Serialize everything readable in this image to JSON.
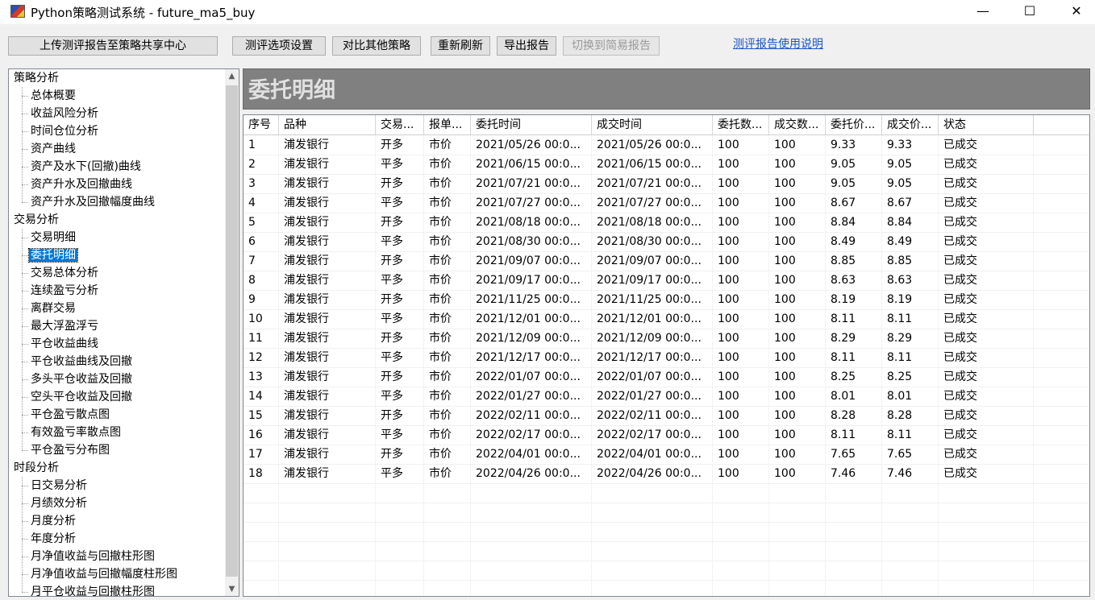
{
  "window": {
    "title": "Python策略测试系统 - future_ma5_buy",
    "minimize": "—",
    "maximize": "☐",
    "close": "✕"
  },
  "toolbar": {
    "upload": "上传测评报告至策略共享中心",
    "options": "测评选项设置",
    "compare": "对比其他策略",
    "refresh": "重新刷新",
    "export": "导出报告",
    "simple": "切换到简易报告",
    "help_link": "测评报告使用说明"
  },
  "tree": {
    "groups": [
      {
        "label": "策略分析",
        "items": [
          "总体概要",
          "收益风险分析",
          "时间仓位分析",
          "资产曲线",
          "资产及水下(回撤)曲线",
          "资产升水及回撤曲线",
          "资产升水及回撤幅度曲线"
        ]
      },
      {
        "label": "交易分析",
        "items": [
          "交易明细",
          "委托明细",
          "交易总体分析",
          "连续盈亏分析",
          "离群交易",
          "最大浮盈浮亏",
          "平仓收益曲线",
          "平仓收益曲线及回撤",
          "多头平仓收益及回撤",
          "空头平仓收益及回撤",
          "平仓盈亏散点图",
          "有效盈亏率散点图",
          "平仓盈亏分布图"
        ]
      },
      {
        "label": "时段分析",
        "items": [
          "日交易分析",
          "月绩效分析",
          "月度分析",
          "年度分析",
          "月净值收益与回撤柱形图",
          "月净值收益与回撤幅度柱形图",
          "月平仓收益与回撤柱形图"
        ]
      }
    ],
    "selected": "委托明细"
  },
  "panel": {
    "title": "委托明细"
  },
  "table": {
    "columns": [
      "序号",
      "品种",
      "交易...",
      "报单...",
      "委托时间",
      "成交时间",
      "委托数...",
      "成交数...",
      "委托价...",
      "成交价...",
      "状态"
    ],
    "rows": [
      [
        "1",
        "浦发银行",
        "开多",
        "市价",
        "2021/05/26 00:0...",
        "2021/05/26 00:0...",
        "100",
        "100",
        "9.33",
        "9.33",
        "已成交"
      ],
      [
        "2",
        "浦发银行",
        "平多",
        "市价",
        "2021/06/15 00:0...",
        "2021/06/15 00:0...",
        "100",
        "100",
        "9.05",
        "9.05",
        "已成交"
      ],
      [
        "3",
        "浦发银行",
        "开多",
        "市价",
        "2021/07/21 00:0...",
        "2021/07/21 00:0...",
        "100",
        "100",
        "9.05",
        "9.05",
        "已成交"
      ],
      [
        "4",
        "浦发银行",
        "平多",
        "市价",
        "2021/07/27 00:0...",
        "2021/07/27 00:0...",
        "100",
        "100",
        "8.67",
        "8.67",
        "已成交"
      ],
      [
        "5",
        "浦发银行",
        "开多",
        "市价",
        "2021/08/18 00:0...",
        "2021/08/18 00:0...",
        "100",
        "100",
        "8.84",
        "8.84",
        "已成交"
      ],
      [
        "6",
        "浦发银行",
        "平多",
        "市价",
        "2021/08/30 00:0...",
        "2021/08/30 00:0...",
        "100",
        "100",
        "8.49",
        "8.49",
        "已成交"
      ],
      [
        "7",
        "浦发银行",
        "开多",
        "市价",
        "2021/09/07 00:0...",
        "2021/09/07 00:0...",
        "100",
        "100",
        "8.85",
        "8.85",
        "已成交"
      ],
      [
        "8",
        "浦发银行",
        "平多",
        "市价",
        "2021/09/17 00:0...",
        "2021/09/17 00:0...",
        "100",
        "100",
        "8.63",
        "8.63",
        "已成交"
      ],
      [
        "9",
        "浦发银行",
        "开多",
        "市价",
        "2021/11/25 00:0...",
        "2021/11/25 00:0...",
        "100",
        "100",
        "8.19",
        "8.19",
        "已成交"
      ],
      [
        "10",
        "浦发银行",
        "平多",
        "市价",
        "2021/12/01 00:0...",
        "2021/12/01 00:0...",
        "100",
        "100",
        "8.11",
        "8.11",
        "已成交"
      ],
      [
        "11",
        "浦发银行",
        "开多",
        "市价",
        "2021/12/09 00:0...",
        "2021/12/09 00:0...",
        "100",
        "100",
        "8.29",
        "8.29",
        "已成交"
      ],
      [
        "12",
        "浦发银行",
        "平多",
        "市价",
        "2021/12/17 00:0...",
        "2021/12/17 00:0...",
        "100",
        "100",
        "8.11",
        "8.11",
        "已成交"
      ],
      [
        "13",
        "浦发银行",
        "开多",
        "市价",
        "2022/01/07 00:0...",
        "2022/01/07 00:0...",
        "100",
        "100",
        "8.25",
        "8.25",
        "已成交"
      ],
      [
        "14",
        "浦发银行",
        "平多",
        "市价",
        "2022/01/27 00:0...",
        "2022/01/27 00:0...",
        "100",
        "100",
        "8.01",
        "8.01",
        "已成交"
      ],
      [
        "15",
        "浦发银行",
        "开多",
        "市价",
        "2022/02/11 00:0...",
        "2022/02/11 00:0...",
        "100",
        "100",
        "8.28",
        "8.28",
        "已成交"
      ],
      [
        "16",
        "浦发银行",
        "平多",
        "市价",
        "2022/02/17 00:0...",
        "2022/02/17 00:0...",
        "100",
        "100",
        "8.11",
        "8.11",
        "已成交"
      ],
      [
        "17",
        "浦发银行",
        "开多",
        "市价",
        "2022/04/01 00:0...",
        "2022/04/01 00:0...",
        "100",
        "100",
        "7.65",
        "7.65",
        "已成交"
      ],
      [
        "18",
        "浦发银行",
        "平多",
        "市价",
        "2022/04/26 00:0...",
        "2022/04/26 00:0...",
        "100",
        "100",
        "7.46",
        "7.46",
        "已成交"
      ]
    ]
  }
}
